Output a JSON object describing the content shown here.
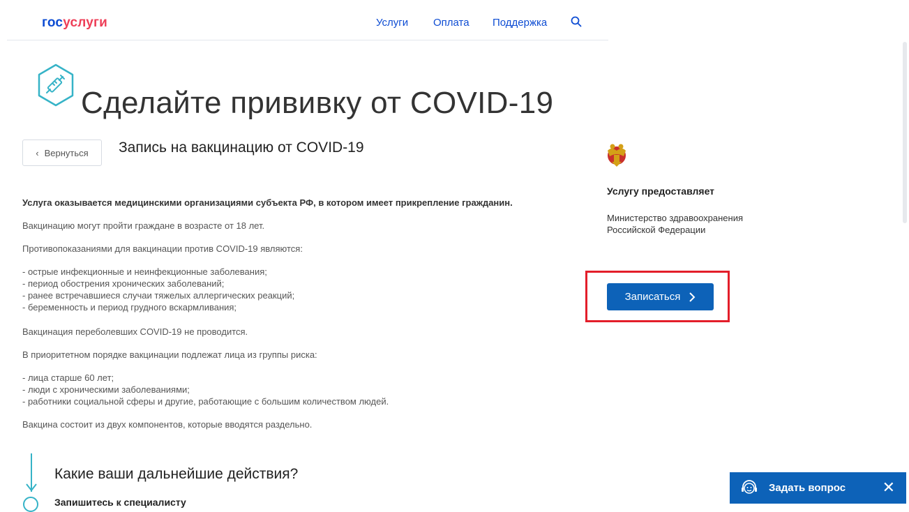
{
  "header": {
    "logo_part1": "гос",
    "logo_part2": "услуги",
    "nav": [
      "Услуги",
      "Оплата",
      "Поддержка"
    ]
  },
  "page": {
    "title": "Сделайте прививку от COVID-19",
    "back_label": "Вернуться",
    "service_title": "Запись на вакцинацию от COVID-19"
  },
  "content": {
    "lead": "Услуга оказывается медицинскими организациями субъекта РФ, в котором имеет прикрепление гражданин.",
    "p1": "Вакцинацию могут пройти граждане в возрасте от 18 лет.",
    "p2": "Противопоказаниями для вакцинации против COVID-19 являются:",
    "contraindications": [
      "- острые инфекционные и неинфекционные заболевания;",
      "- период обострения хронических заболеваний;",
      "- ранее встречавшиеся случаи тяжелых аллергических реакций;",
      "- беременность и период грудного вскармливания;"
    ],
    "p3": "Вакцинация переболевших COVID-19 не проводится.",
    "p4": "В приоритетном порядке вакцинации подлежат лица из группы риска:",
    "risk_groups": [
      "- лица старше 60 лет;",
      "- люди с хроническими заболеваниями;",
      "- работники социальной сферы и другие, работающие с большим количеством людей."
    ],
    "p5": "Вакцина состоит из двух компонентов, которые вводятся раздельно."
  },
  "steps": {
    "title": "Какие ваши дальнейшие действия?",
    "first_step": "Запишитесь к специалисту"
  },
  "provider": {
    "heading": "Услугу предоставляет",
    "name": "Министерство здравоохранения Российской Федерации"
  },
  "actions": {
    "signup_label": "Записаться"
  },
  "chat": {
    "label": "Задать вопрос"
  },
  "colors": {
    "brand_blue": "#0d4cd3",
    "brand_red": "#ee3f58",
    "button_blue": "#0d62b8",
    "highlight_red": "#e31e2a",
    "accent_teal": "#36b3c7"
  },
  "icons": [
    "search-icon",
    "syringe-icon",
    "chevron-left-icon",
    "coat-of-arms-emblem",
    "chevron-right-icon",
    "headset-icon",
    "close-icon",
    "arrow-down-icon"
  ]
}
